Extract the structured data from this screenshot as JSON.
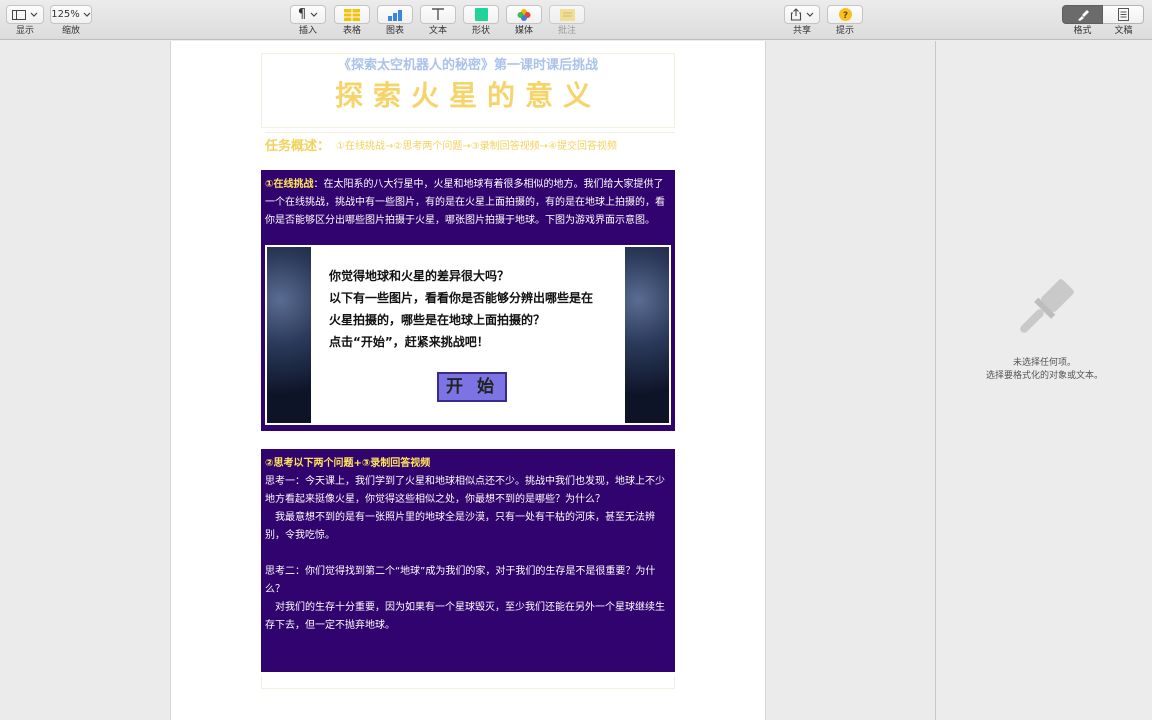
{
  "toolbar": {
    "view": {
      "label": "显示"
    },
    "zoom": {
      "value": "125%",
      "label": "缩放"
    },
    "insert": {
      "icon": "¶",
      "label": "插入"
    },
    "table": {
      "label": "表格"
    },
    "chart": {
      "label": "图表"
    },
    "text": {
      "label": "文本"
    },
    "shape": {
      "label": "形状"
    },
    "media": {
      "label": "媒体"
    },
    "comment": {
      "label": "批注"
    },
    "share": {
      "label": "共享"
    },
    "tips": {
      "label": "提示"
    },
    "format": {
      "label": "格式"
    },
    "document": {
      "label": "文稿"
    }
  },
  "colors": {
    "purple_bg": "#31036e",
    "title_yellow": "#f6d46b",
    "subtitle_blue": "#aac3ea",
    "highlight_yellow": "#ffe45c",
    "start_button": "#7d74e4"
  },
  "document": {
    "subtitle": "《探索太空机器人的秘密》第一课时课后挑战",
    "title": "探索火星的意义",
    "task_label": "任务概述：",
    "task_text": "①在线挑战→②思考两个问题→③录制回答视频→④提交回答视频",
    "section1": {
      "heading": "①在线挑战",
      "text": "：在太阳系的八大行星中，火星和地球有着很多相似的地方。我们给大家提供了一个在线挑战，挑战中有一些图片，有的是在火星上面拍摄的，有的是在地球上拍摄的，看你是否能够区分出哪些图片拍摄于火星，哪张图片拍摄于地球。下图为游戏界面示意图。",
      "game": {
        "line1": "你觉得地球和火星的差异很大吗？",
        "line2": "以下有一些图片，看看你是否能够分辨出哪些是在",
        "line3": "火星拍摄的，哪些是在地球上面拍摄的？",
        "line4": "点击“开始”，赶紧来挑战吧！",
        "start_button": "开 始"
      }
    },
    "section2": {
      "heading": "②思考以下两个问题+③录制回答视频",
      "q1": "思考一：今天课上，我们学到了火星和地球相似点还不少。挑战中我们也发现，地球上不少地方看起来挺像火星，你觉得这些相似之处，你最想不到的是哪些？为什么？",
      "a1": "我最意想不到的是有一张照片里的地球全是沙漠，只有一处有干枯的河床，甚至无法辨别，令我吃惊。",
      "q2": "思考二：你们觉得找到第二个“地球”成为我们的家，对于我们的生存是不是很重要？为什么？",
      "a2": "对我们的生存十分重要，因为如果有一个星球毁灭，至少我们还能在另外一个星球继续生存下去，但一定不抛弃地球。"
    }
  },
  "panel": {
    "line1": "未选择任何项。",
    "line2": "选择要格式化的对象或文本。"
  }
}
